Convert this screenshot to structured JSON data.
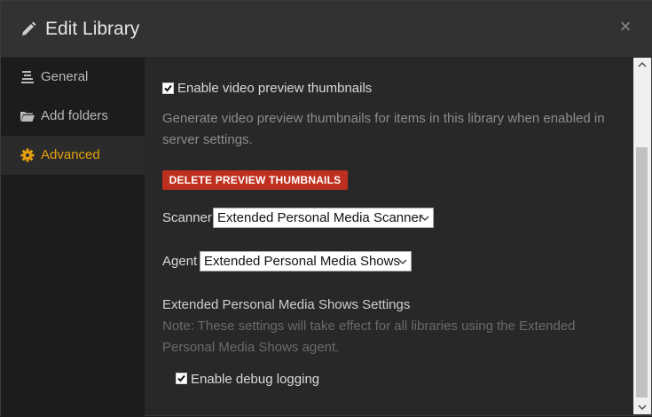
{
  "dialog": {
    "title": "Edit Library",
    "close_glyph": "×",
    "pencil_icon": "pencil-icon"
  },
  "sidebar": {
    "items": [
      {
        "label": "General",
        "icon": "list-icon",
        "active": false
      },
      {
        "label": "Add folders",
        "icon": "folder-icon",
        "active": false
      },
      {
        "label": "Advanced",
        "icon": "gear-icon",
        "active": true
      }
    ]
  },
  "advanced": {
    "preview_thumbnails": {
      "label": "Enable video preview thumbnails",
      "checked": true,
      "help_line1": "Generate video preview thumbnails for items in this library when enabled in",
      "help_line2": "server settings."
    },
    "delete_button": "DELETE PREVIEW THUMBNAILS",
    "scanner": {
      "label": "Scanner",
      "value": "Extended Personal Media Scanner"
    },
    "agent": {
      "label": "Agent",
      "value": "Extended Personal Media Shows"
    },
    "agent_settings": {
      "heading": "Extended Personal Media Shows Settings",
      "note_line1": "Note: These settings will take effect for all libraries using the Extended",
      "note_line2": "Personal Media Shows agent."
    },
    "debug_logging": {
      "label": "Enable debug logging",
      "checked": true
    }
  },
  "colors": {
    "accent": "#e5a00d",
    "danger": "#bf2f1f",
    "background": "#282828",
    "sidebar": "#1c1c1c"
  }
}
